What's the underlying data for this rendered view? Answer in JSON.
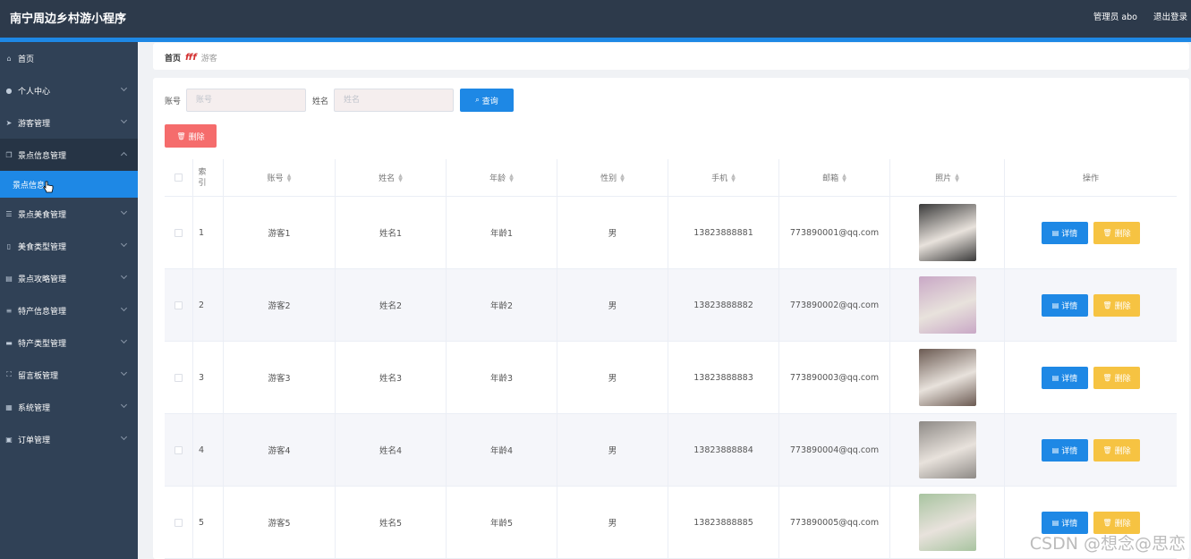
{
  "app": {
    "title": "南宁周边乡村游小程序",
    "admin_label": "管理员 abo",
    "logout_label": "退出登录"
  },
  "sidebar": {
    "items": [
      {
        "label": "首页",
        "icon": "home-icon",
        "has_children": false
      },
      {
        "label": "个人中心",
        "icon": "user-icon",
        "has_children": true
      },
      {
        "label": "游客管理",
        "icon": "send-icon",
        "has_children": true
      },
      {
        "label": "景点信息管理",
        "icon": "copy-icon",
        "has_children": true,
        "open": true
      },
      {
        "label": "景点美食管理",
        "icon": "sliders-icon",
        "has_children": true
      },
      {
        "label": "美食类型管理",
        "icon": "phone-icon",
        "has_children": true
      },
      {
        "label": "景点攻略管理",
        "icon": "clipboard-icon",
        "has_children": true
      },
      {
        "label": "特产信息管理",
        "icon": "list-icon",
        "has_children": true
      },
      {
        "label": "特产类型管理",
        "icon": "stack-icon",
        "has_children": true
      },
      {
        "label": "留言板管理",
        "icon": "frame-icon",
        "has_children": true
      },
      {
        "label": "系统管理",
        "icon": "grid-icon",
        "has_children": true
      },
      {
        "label": "订单管理",
        "icon": "doc-icon",
        "has_children": true
      }
    ],
    "active_sub": {
      "label": "景点信息"
    }
  },
  "breadcrumb": {
    "home": "首页",
    "separator": "fff",
    "current": "游客"
  },
  "search": {
    "account_label": "账号",
    "account_placeholder": "账号",
    "name_label": "姓名",
    "name_placeholder": "姓名",
    "query_button": "查询"
  },
  "actions": {
    "batch_delete": "删除"
  },
  "table": {
    "headers": [
      "索引",
      "账号",
      "姓名",
      "年龄",
      "性别",
      "手机",
      "邮箱",
      "照片",
      "操作"
    ],
    "detail_label": "详情",
    "delete_label": "删除",
    "rows": [
      {
        "index": "1",
        "account": "游客1",
        "name": "姓名1",
        "age": "年龄1",
        "gender": "男",
        "phone": "13823888881",
        "email": "773890001@qq.com",
        "photo_color": "#3a3a3a"
      },
      {
        "index": "2",
        "account": "游客2",
        "name": "姓名2",
        "age": "年龄2",
        "gender": "男",
        "phone": "13823888882",
        "email": "773890002@qq.com",
        "photo_color": "#c9a8c6"
      },
      {
        "index": "3",
        "account": "游客3",
        "name": "姓名3",
        "age": "年龄3",
        "gender": "男",
        "phone": "13823888883",
        "email": "773890003@qq.com",
        "photo_color": "#6b5a52"
      },
      {
        "index": "4",
        "account": "游客4",
        "name": "姓名4",
        "age": "年龄4",
        "gender": "男",
        "phone": "13823888884",
        "email": "773890004@qq.com",
        "photo_color": "#8e8a86"
      },
      {
        "index": "5",
        "account": "游客5",
        "name": "姓名5",
        "age": "年龄5",
        "gender": "男",
        "phone": "13823888885",
        "email": "773890005@qq.com",
        "photo_color": "#a8c4a0"
      }
    ]
  },
  "watermark": "CSDN @想念@思恋",
  "colors": {
    "topbar": "#2d3a4b",
    "sidebar": "#304156",
    "accent": "#1e88e5",
    "danger": "#f56c6c",
    "warning": "#f6c342"
  }
}
